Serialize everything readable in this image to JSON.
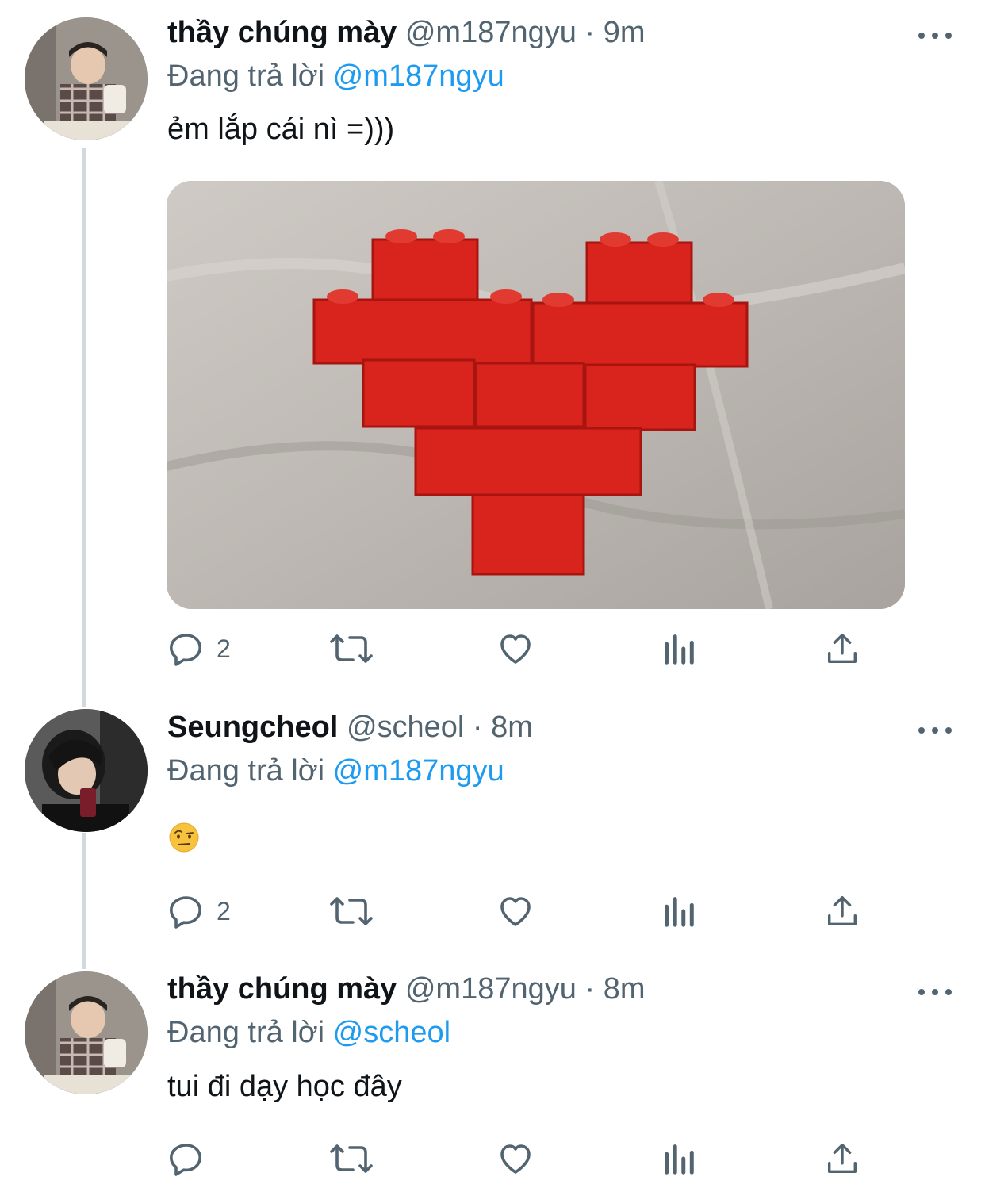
{
  "tweets": [
    {
      "name": "thầy chúng mày",
      "handle": "@m187ngyu",
      "separator": "·",
      "time": "9m",
      "reply_prefix": "Đang trả lời",
      "reply_to": "@m187ngyu",
      "text": "ẻm lắp cái nì =)))",
      "reply_count": "2"
    },
    {
      "name": "Seungcheol",
      "handle": "@scheol",
      "separator": "·",
      "time": "8m",
      "reply_prefix": "Đang trả lời",
      "reply_to": "@m187ngyu",
      "emoji": "face-with-raised-eyebrow",
      "reply_count": "2"
    },
    {
      "name": "thầy chúng mày",
      "handle": "@m187ngyu",
      "separator": "·",
      "time": "8m",
      "reply_prefix": "Đang trả lời",
      "reply_to": "@scheol",
      "text": "tui đi dạy học đây",
      "reply_count": ""
    }
  ],
  "icons": [
    "reply-icon",
    "retweet-icon",
    "like-icon",
    "analytics-icon",
    "share-icon",
    "more-icon"
  ],
  "colors": {
    "text": "#0f1419",
    "secondary": "#536471",
    "link": "#1d9bf0",
    "thread_line": "#cfd9de",
    "heart_red": "#d9231d"
  },
  "media": {
    "subject": "red-brick-heart",
    "background": "grey-fabric"
  }
}
